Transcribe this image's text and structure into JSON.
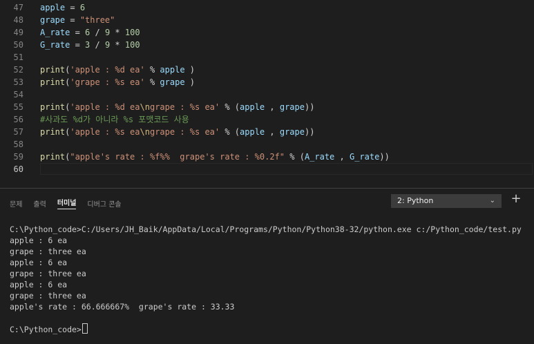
{
  "editor": {
    "lines": [
      {
        "n": "47",
        "tokens": [
          [
            "v",
            "apple"
          ],
          [
            "o",
            " = "
          ],
          [
            "n",
            "6"
          ]
        ]
      },
      {
        "n": "48",
        "tokens": [
          [
            "v",
            "grape"
          ],
          [
            "o",
            " = "
          ],
          [
            "s",
            "\"three\""
          ]
        ]
      },
      {
        "n": "49",
        "tokens": [
          [
            "v",
            "A_rate"
          ],
          [
            "o",
            " = "
          ],
          [
            "n",
            "6"
          ],
          [
            "o",
            " / "
          ],
          [
            "n",
            "9"
          ],
          [
            "o",
            " * "
          ],
          [
            "n",
            "100"
          ]
        ]
      },
      {
        "n": "50",
        "tokens": [
          [
            "v",
            "G_rate"
          ],
          [
            "o",
            " = "
          ],
          [
            "n",
            "3"
          ],
          [
            "o",
            " / "
          ],
          [
            "n",
            "9"
          ],
          [
            "o",
            " * "
          ],
          [
            "n",
            "100"
          ]
        ]
      },
      {
        "n": "51",
        "tokens": []
      },
      {
        "n": "52",
        "tokens": [
          [
            "f",
            "print"
          ],
          [
            "o",
            "("
          ],
          [
            "s",
            "'apple : %d ea'"
          ],
          [
            "o",
            " % "
          ],
          [
            "v",
            "apple"
          ],
          [
            "o",
            " )"
          ]
        ]
      },
      {
        "n": "53",
        "tokens": [
          [
            "f",
            "print"
          ],
          [
            "o",
            "("
          ],
          [
            "s",
            "'grape : %s ea'"
          ],
          [
            "o",
            " % "
          ],
          [
            "v",
            "grape"
          ],
          [
            "o",
            " )"
          ]
        ]
      },
      {
        "n": "54",
        "tokens": []
      },
      {
        "n": "55",
        "tokens": [
          [
            "f",
            "print"
          ],
          [
            "o",
            "("
          ],
          [
            "s",
            "'apple : %d ea"
          ],
          [
            "e",
            "\\n"
          ],
          [
            "s",
            "grape : %s ea'"
          ],
          [
            "o",
            " % ("
          ],
          [
            "v",
            "apple"
          ],
          [
            "o",
            " , "
          ],
          [
            "v",
            "grape"
          ],
          [
            "o",
            "))"
          ]
        ]
      },
      {
        "n": "56",
        "tokens": [
          [
            "c",
            "#사과도 %d가 아니라 %s 포맷코드 사용"
          ]
        ]
      },
      {
        "n": "57",
        "tokens": [
          [
            "f",
            "print"
          ],
          [
            "o",
            "("
          ],
          [
            "s",
            "'apple : %s ea"
          ],
          [
            "e",
            "\\n"
          ],
          [
            "s",
            "grape : %s ea'"
          ],
          [
            "o",
            " % ("
          ],
          [
            "v",
            "apple"
          ],
          [
            "o",
            " , "
          ],
          [
            "v",
            "grape"
          ],
          [
            "o",
            "))"
          ]
        ]
      },
      {
        "n": "58",
        "tokens": []
      },
      {
        "n": "59",
        "tokens": [
          [
            "f",
            "print"
          ],
          [
            "o",
            "("
          ],
          [
            "s",
            "\"apple's rate : %f%%  grape's rate : %0.2f\""
          ],
          [
            "o",
            " % ("
          ],
          [
            "v",
            "A_rate"
          ],
          [
            "o",
            " , "
          ],
          [
            "v",
            "G_rate"
          ],
          [
            "o",
            "))"
          ]
        ]
      },
      {
        "n": "60",
        "tokens": []
      }
    ],
    "active_line": "60"
  },
  "panel": {
    "tabs": [
      {
        "label": "문제",
        "active": false
      },
      {
        "label": "출력",
        "active": false
      },
      {
        "label": "터미널",
        "active": true
      },
      {
        "label": "디버그 콘솔",
        "active": false
      }
    ],
    "terminal_select": "2: Python",
    "chevron_icon": "chevron-down-icon",
    "plus_icon": "plus-icon",
    "plus_label": "+",
    "chevron_label": "⌄"
  },
  "terminal": {
    "lines": [
      "C:\\Python_code>C:/Users/JH_Baik/AppData/Local/Programs/Python/Python38-32/python.exe c:/Python_code/test.py",
      "apple : 6 ea",
      "grape : three ea",
      "apple : 6 ea",
      "grape : three ea",
      "apple : 6 ea",
      "grape : three ea",
      "apple's rate : 66.666667%  grape's rate : 33.33",
      "",
      "C:\\Python_code>"
    ]
  }
}
